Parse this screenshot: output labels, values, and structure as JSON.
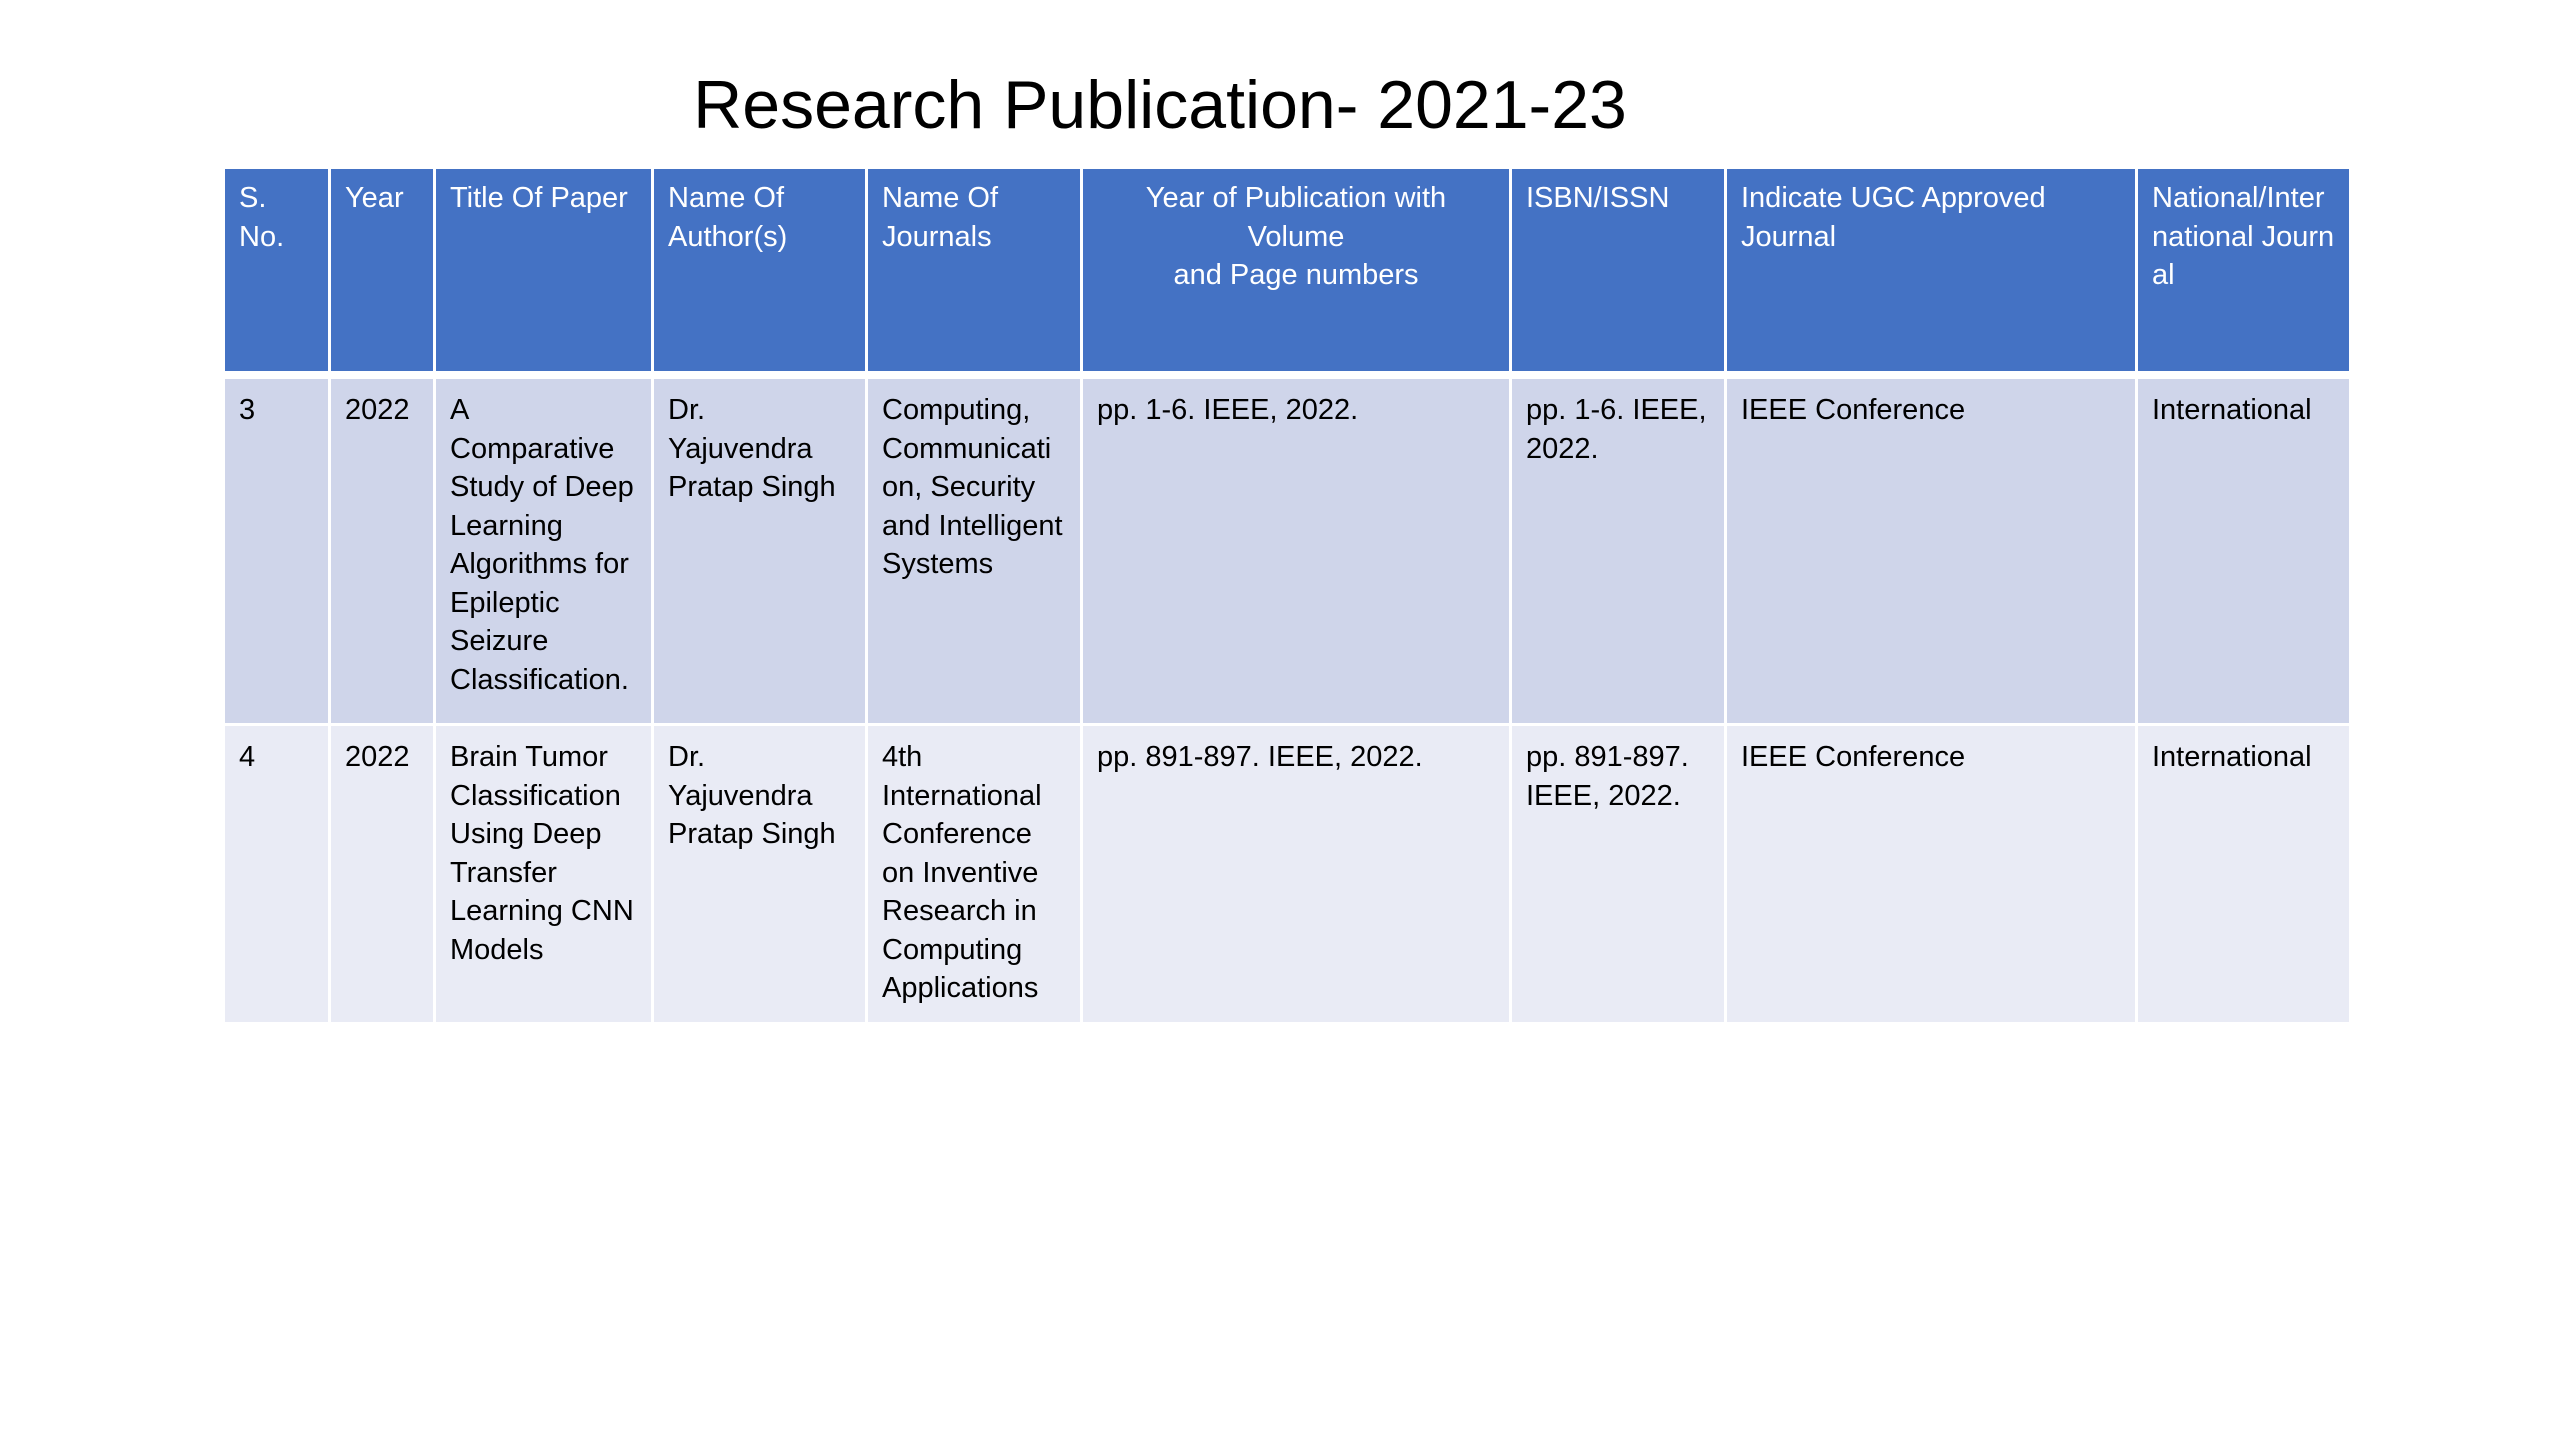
{
  "slide": {
    "title": "Research Publication- 2021-23"
  },
  "table": {
    "headers": [
      "S. No.",
      "Year",
      "Title Of Paper",
      "Name Of Author(s)",
      "Name Of Journals",
      "Year of Publication with Volume\nand Page numbers",
      "ISBN/ISSN",
      "Indicate UGC Approved Journal",
      "National/Inter national Journal"
    ],
    "rows": [
      {
        "sno": "3",
        "year": "2022",
        "title": "A Comparative Study of Deep Learning Algorithms for Epileptic Seizure Classification.",
        "authors": "Dr. Yajuvendra Pratap Singh",
        "journal": "Computing, Communication, Security and Intelligent Systems",
        "publication": "pp. 1-6. IEEE, 2022.",
        "isbn": "pp. 1-6. IEEE, 2022.",
        "ugc": "IEEE Conference",
        "scope": "International"
      },
      {
        "sno": "4",
        "year": "2022",
        "title": "Brain Tumor Classification Using Deep Transfer Learning CNN Models",
        "authors": "Dr. Yajuvendra Pratap Singh",
        "journal": "4th International Conference on Inventive Research in Computing Applications",
        "publication": "pp. 891-897. IEEE, 2022.",
        "isbn": "pp. 891-897. IEEE, 2022.",
        "ugc": "IEEE Conference",
        "scope": "International"
      }
    ]
  },
  "colors": {
    "header_bg": "#4472c4",
    "row_odd_bg": "#cfd5ea",
    "row_even_bg": "#e9ebf5"
  }
}
